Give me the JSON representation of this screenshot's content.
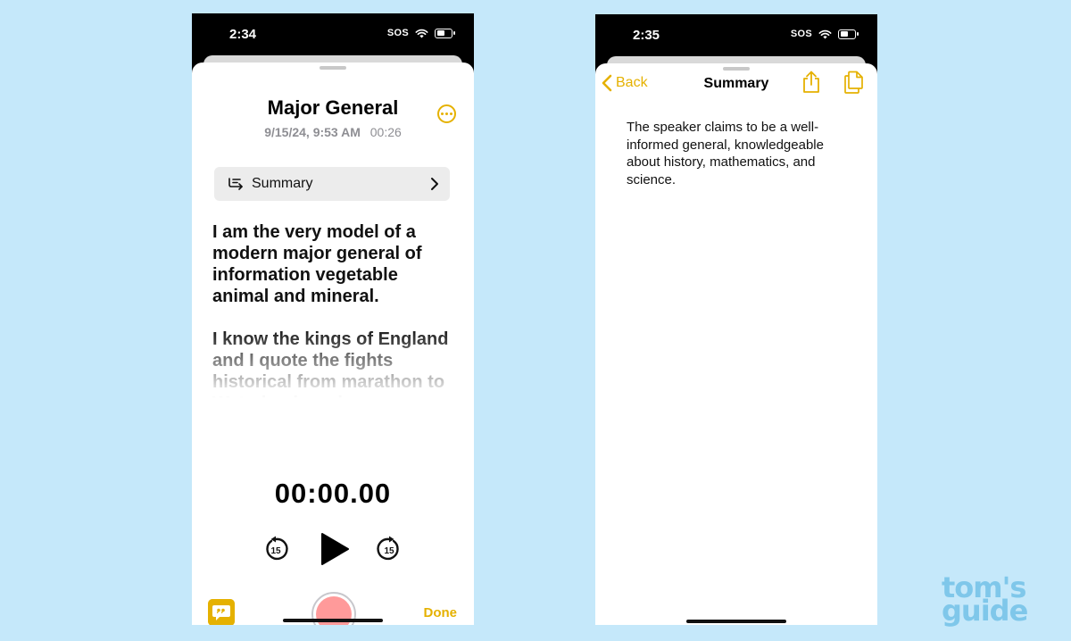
{
  "left_screen": {
    "status": {
      "time": "2:34",
      "sos": "SOS"
    },
    "title": "Major General",
    "date": "9/15/24, 9:53 AM",
    "duration": "00:26",
    "summary_label": "Summary",
    "transcript": [
      "I am the very model of a modern major general of information vegetable animal and mineral.",
      "I know the kings of England and I quote the fights historical from marathon to Waterloo in order."
    ],
    "timer": "00:00.00",
    "skip_back_label": "15",
    "skip_forward_label": "15",
    "done_label": "Done"
  },
  "right_screen": {
    "status": {
      "time": "2:35",
      "sos": "SOS"
    },
    "back_label": "Back",
    "title": "Summary",
    "summary_text": "The speaker claims to be a well-informed general, knowledgeable about history, mathematics, and science."
  },
  "watermark": {
    "line1": "tom's",
    "line2": "guide"
  },
  "colors": {
    "background": "#c5e8fa",
    "accent": "#e5b100",
    "record": "#ff9a9a",
    "watermark": "#7fc7ea"
  },
  "icons": [
    "more-icon",
    "summary-list-icon",
    "chevron-right-icon",
    "skip-back-15-icon",
    "play-icon",
    "skip-forward-15-icon",
    "quote-bubble-icon",
    "record-icon",
    "chevron-left-icon",
    "share-icon",
    "copy-icon",
    "wifi-icon",
    "battery-icon"
  ]
}
